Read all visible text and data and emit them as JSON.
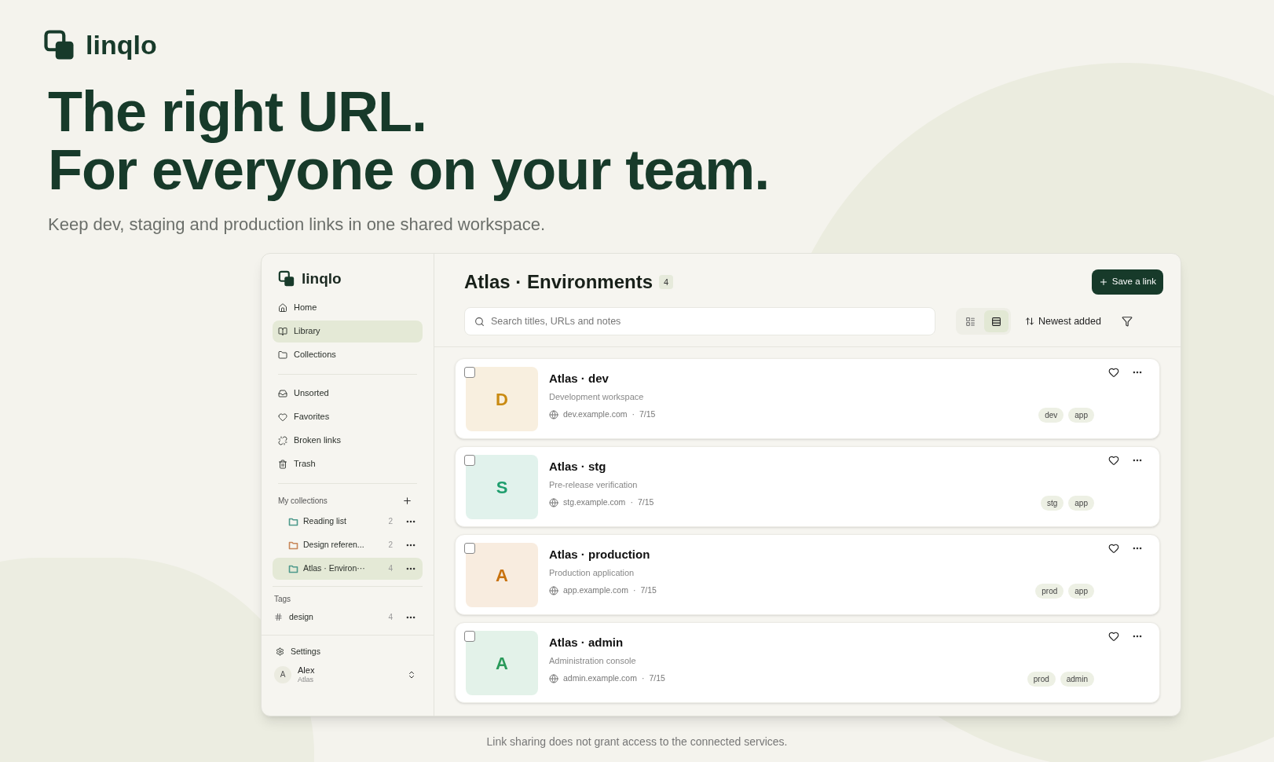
{
  "brand": {
    "name": "linqlo"
  },
  "hero": {
    "headline": [
      "The right URL.",
      "For everyone on your team."
    ],
    "subtitle": "Keep dev, staging and production links in one shared workspace."
  },
  "app": {
    "brand": "linqlo",
    "nav": [
      {
        "label": "Home",
        "selected": false
      },
      {
        "label": "Library",
        "selected": true
      },
      {
        "label": "Collections",
        "selected": false
      }
    ],
    "nav2": [
      {
        "label": "Unsorted",
        "selected": false
      },
      {
        "label": "Favorites",
        "selected": false
      },
      {
        "label": "Broken links",
        "selected": false
      },
      {
        "label": "Trash",
        "selected": false
      }
    ],
    "collections_title": "My collections",
    "collections": [
      {
        "label": "Reading list",
        "count": "2",
        "color": "#4e9a8c",
        "selected": false
      },
      {
        "label": "Design referen...",
        "count": "2",
        "color": "#c8875a",
        "selected": false
      },
      {
        "label": "Atlas · Environ···",
        "count": "4",
        "color": "#4e9a8c",
        "selected": true
      }
    ],
    "tags_title": "Tags",
    "tags": [
      {
        "label": "design",
        "count": "4"
      }
    ],
    "settings": "Settings",
    "user": {
      "initial": "A",
      "name": "Alex",
      "workspace": "Atlas"
    },
    "title": "Atlas · Environments",
    "count": "4",
    "save_button": "Save a link",
    "search": {
      "placeholder": "Search titles, URLs and notes"
    },
    "views": [
      {
        "kind": "cards",
        "selected": false
      },
      {
        "kind": "rows",
        "selected": true
      }
    ],
    "sort": "Newest added",
    "links": [
      {
        "letter": "D",
        "color": "#c98a12",
        "title": "Atlas · dev",
        "description": "Development workspace",
        "domain": "dev.example.com",
        "separator": "·",
        "date": "7/15",
        "tags": [
          "dev",
          "app"
        ],
        "checked": false
      },
      {
        "letter": "S",
        "color": "#1f9e6e",
        "title": "Atlas · stg",
        "description": "Pre-release verification",
        "domain": "stg.example.com",
        "separator": "·",
        "date": "7/15",
        "tags": [
          "stg",
          "app"
        ],
        "checked": false
      },
      {
        "letter": "A",
        "color": "#c8720f",
        "title": "Atlas · production",
        "description": "Production application",
        "domain": "app.example.com",
        "separator": "·",
        "date": "7/15",
        "tags": [
          "prod",
          "app"
        ],
        "checked": false
      },
      {
        "letter": "A",
        "color": "#2a9a5a",
        "title": "Atlas · admin",
        "description": "Administration console",
        "domain": "admin.example.com",
        "separator": "·",
        "date": "7/15",
        "tags": [
          "prod",
          "admin"
        ],
        "checked": false
      }
    ]
  },
  "footnote": "Link sharing does not grant access to the connected services."
}
